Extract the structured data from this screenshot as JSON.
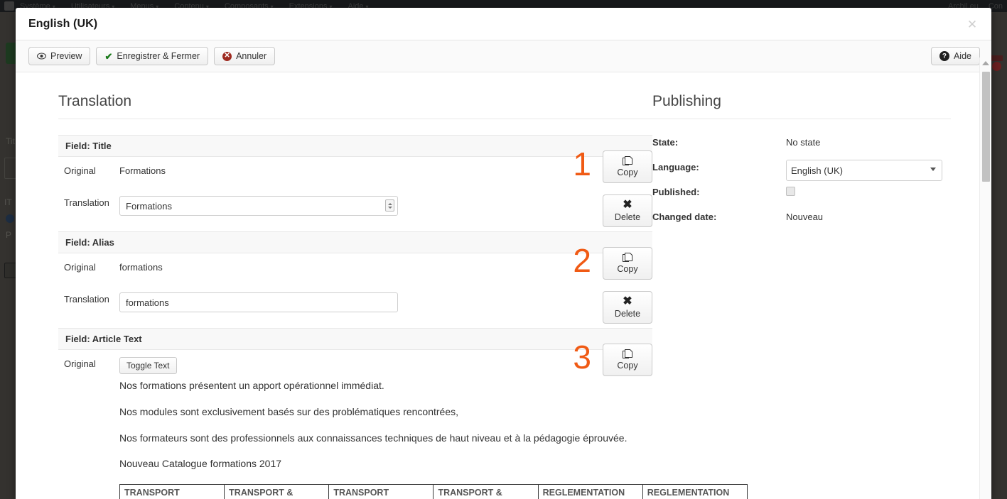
{
  "background": {
    "menu_items": [
      {
        "label": "Système"
      },
      {
        "label": "Utilisateurs"
      },
      {
        "label": "Menus"
      },
      {
        "label": "Contenu"
      },
      {
        "label": "Composants"
      },
      {
        "label": "Extensions"
      },
      {
        "label": "Aide"
      }
    ],
    "right_items": [
      {
        "label": "Archil.eu"
      },
      {
        "label": "Con"
      }
    ],
    "caret": "▾",
    "labels": {
      "title_field": "Tit",
      "it_label": "IT",
      "p_label": "P"
    }
  },
  "modal": {
    "title": "English (UK)",
    "close_label": "✕",
    "toolbar": {
      "preview_label": "Preview",
      "save_close_label": "Enregistrer & Fermer",
      "cancel_label": "Annuler",
      "help_label": "Aide",
      "icons": {
        "preview": "eye-icon",
        "save": "check-icon",
        "cancel": "cancel-icon",
        "help": "help-icon"
      }
    }
  },
  "translation": {
    "section_title": "Translation",
    "labels": {
      "original": "Original",
      "translation": "Translation",
      "copy": "Copy",
      "delete": "Delete",
      "toggle_text": "Toggle Text"
    },
    "fields": [
      {
        "marker": "1",
        "heading": "Field: Title",
        "original": "Formations",
        "translation_value": "Formations"
      },
      {
        "marker": "2",
        "heading": "Field: Alias",
        "original": "formations",
        "translation_value": "formations"
      },
      {
        "marker": "3",
        "heading": "Field: Article Text",
        "paragraphs": [
          "Nos formations présentent un apport opérationnel immédiat.",
          "Nos modules sont exclusivement basés sur des problématiques rencontrées,",
          "Nos formateurs sont des professionnels aux connaissances techniques de haut niveau et à la pédagogie éprouvée.",
          "Nouveau Catalogue formations 2017"
        ],
        "table_headers": [
          "TRANSPORT",
          "TRANSPORT &",
          "TRANSPORT",
          "TRANSPORT &",
          "REGLEMENTATION",
          "REGLEMENTATION"
        ]
      }
    ]
  },
  "publishing": {
    "section_title": "Publishing",
    "state_label": "State:",
    "state_value": "No state",
    "language_label": "Language:",
    "language_value": "English (UK)",
    "published_label": "Published:",
    "published_checked": false,
    "changed_date_label": "Changed date:",
    "changed_date_value": "Nouveau"
  },
  "colors": {
    "marker_orange": "#f05a14",
    "save_green": "#1a7a1a",
    "cancel_red": "#9e2a20"
  }
}
